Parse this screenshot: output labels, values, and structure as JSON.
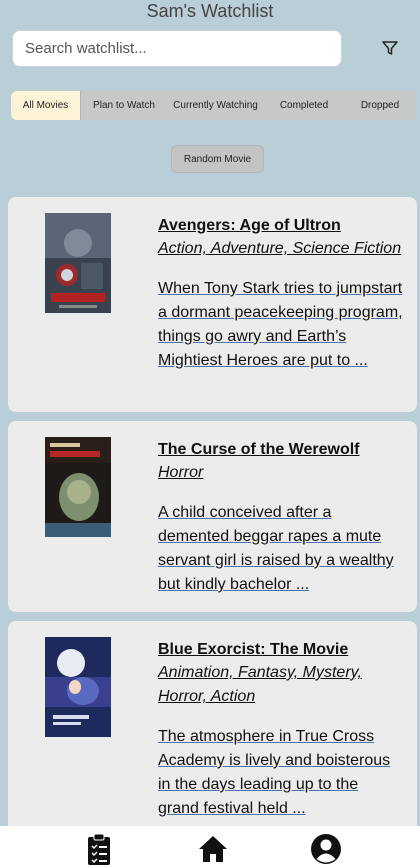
{
  "header": {
    "title": "Sam's Watchlist"
  },
  "search": {
    "placeholder": "Search watchlist..."
  },
  "icons": {
    "filter": "filter-icon",
    "watchlist": "clipboard-list-icon",
    "home": "home-icon",
    "profile": "user-circle-icon"
  },
  "tabs": [
    {
      "label": "All Movies",
      "active": true
    },
    {
      "label": "Plan to Watch",
      "active": false
    },
    {
      "label": "Currently Watching",
      "active": false
    },
    {
      "label": "Completed",
      "active": false
    },
    {
      "label": "Dropped",
      "active": false
    }
  ],
  "random_button": {
    "label": "Random Movie"
  },
  "movies": [
    {
      "title": "Avengers: Age of Ultron",
      "genres": "Action, Adventure, Science Fiction",
      "description": "When Tony Stark tries to jumpstart a dormant peacekeeping program, things go awry and Earth’s Mightiest Heroes are put to ..."
    },
    {
      "title": "The Curse of the Werewolf",
      "genres": "Horror",
      "description": "A child conceived after a demented beggar rapes a mute servant girl is raised by a wealthy but kindly bachelor ..."
    },
    {
      "title": "Blue Exorcist: The Movie",
      "genres": "Animation, Fantasy, Mystery, Horror, Action",
      "description": "The atmosphere in True Cross Academy is lively and boisterous in the days leading up to the grand festival held ..."
    }
  ],
  "colors": {
    "background": "#b9ced6",
    "card": "#ececec",
    "active_tab": "#fdf3d6",
    "tab_bar": "#c7c9c9"
  }
}
